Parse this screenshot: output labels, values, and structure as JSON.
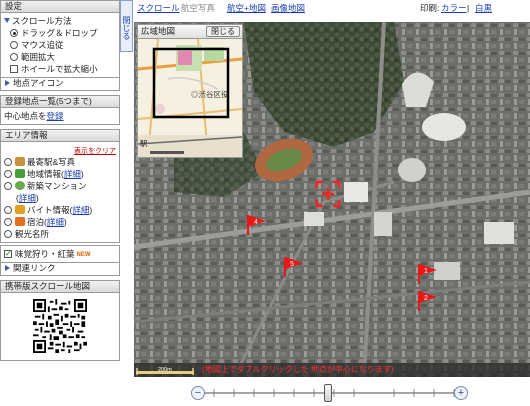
{
  "left_panel": {
    "settings": {
      "header": "設定",
      "scroll_method_label": "スクロール方法",
      "scroll_options": [
        "ドラッグ＆ドロップ",
        "マウス追従",
        "範囲拡大"
      ],
      "wheel_zoom_label": "ホイールで拡大縮小",
      "point_icon_label": "地点アイコン"
    },
    "registered": {
      "header": "登録地点一覧(5つまで)",
      "center_label": "中心地点を",
      "register_link": "登録"
    },
    "area_info": {
      "header": "エリア情報",
      "clear_link": "表示をクリア",
      "items": [
        {
          "label": "最寄駅&写真",
          "detail": ""
        },
        {
          "label": "地域情報",
          "detail": "詳細"
        },
        {
          "label": "新築マンション",
          "detail": "詳細"
        },
        {
          "label": "バイト情報",
          "detail": "詳細"
        },
        {
          "label": "宿泊",
          "detail": "詳細"
        },
        {
          "label": "観光名所",
          "detail": ""
        }
      ],
      "autumn_label": "味覚狩り・紅葉",
      "new_badge": "NEW",
      "related_link": "関連リンク"
    },
    "mobile": {
      "header": "携帯版スクロール地図"
    }
  },
  "collapse_tab": {
    "label": "閉じる"
  },
  "top_bar": {
    "scroll": "スクロール",
    "aerial": "航空写真",
    "aerial_map": "航空+地図",
    "image_map": "画像地図",
    "print_label": "印刷:",
    "color": "カラー",
    "separator": "|",
    "monochrome": "白黒"
  },
  "overview": {
    "title": "広域地図",
    "close": "閉じる",
    "school_label": "◎渋谷区役",
    "station_label": "駅"
  },
  "map": {
    "markers": [
      "1",
      "2",
      "4",
      "5"
    ],
    "scale_label": "200m",
    "hint": "(地図上でダブルクリックした 地点が中心になります)",
    "colors": {
      "marker": "#e81818",
      "hint": "#d01010"
    }
  },
  "zoom": {
    "minus": "−",
    "plus": "+",
    "level_fraction": 0.5
  }
}
